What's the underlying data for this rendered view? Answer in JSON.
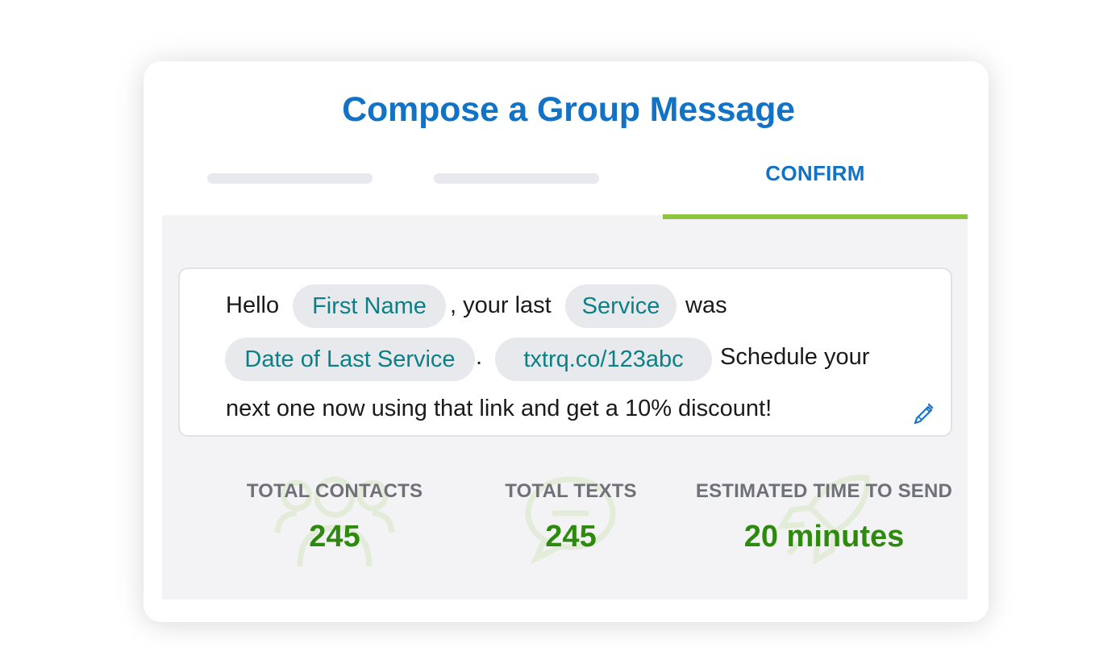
{
  "dialog": {
    "title": "Compose a Group Message"
  },
  "steps": {
    "active_tab_label": "CONFIRM"
  },
  "message": {
    "hello": "Hello",
    "after_first_name": ", your last",
    "was": "was",
    "after_date": ".",
    "schedule": "Schedule your",
    "line3": "next one now using that link and get a 10% discount!",
    "chips": {
      "first_name": "First Name",
      "service": "Service",
      "date_of_last_service": "Date of Last Service",
      "link": "txtrq.co/123abc"
    }
  },
  "stats": {
    "contacts": {
      "label": "TOTAL CONTACTS",
      "value": "245",
      "icon": "users-icon"
    },
    "texts": {
      "label": "TOTAL TEXTS",
      "value": "245",
      "icon": "chat-bubble-icon"
    },
    "time": {
      "label": "ESTIMATED TIME TO SEND",
      "value": "20 minutes",
      "icon": "rocket-icon"
    }
  },
  "colors": {
    "title_blue": "#1273c6",
    "accent_green": "#8cc43f",
    "value_green": "#2e8a0f",
    "chip_text_teal": "#0d7f86",
    "panel_gray": "#f3f3f5"
  }
}
